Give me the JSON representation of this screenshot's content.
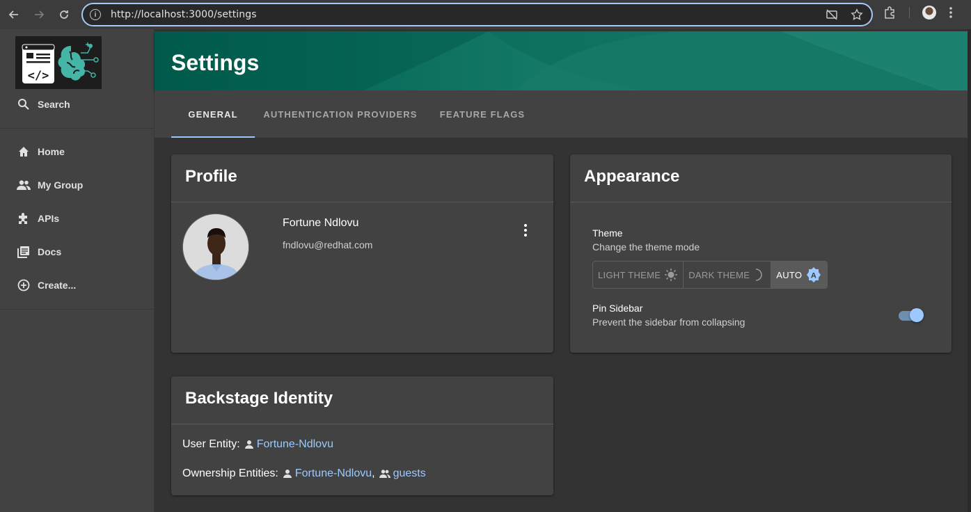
{
  "browser": {
    "url": "http://localhost:3000/settings",
    "back_icon": "arrow-left-icon",
    "forward_icon": "arrow-right-icon",
    "reload_icon": "reload-icon"
  },
  "sidebar": {
    "search_label": "Search",
    "items": [
      {
        "label": "Home",
        "icon": "home-icon"
      },
      {
        "label": "My Group",
        "icon": "group-icon"
      },
      {
        "label": "APIs",
        "icon": "puzzle-icon"
      },
      {
        "label": "Docs",
        "icon": "docs-icon"
      },
      {
        "label": "Create...",
        "icon": "add-circle-icon"
      }
    ]
  },
  "header": {
    "title": "Settings"
  },
  "tabs": [
    {
      "label": "GENERAL",
      "active": true
    },
    {
      "label": "AUTHENTICATION PROVIDERS",
      "active": false
    },
    {
      "label": "FEATURE FLAGS",
      "active": false
    }
  ],
  "profile": {
    "title": "Profile",
    "name": "Fortune Ndlovu",
    "email": "fndlovu@redhat.com"
  },
  "appearance": {
    "title": "Appearance",
    "theme_label": "Theme",
    "theme_desc": "Change the theme mode",
    "theme_options": [
      {
        "label": "LIGHT THEME",
        "icon": "sun-icon"
      },
      {
        "label": "DARK THEME",
        "icon": "moon-icon"
      },
      {
        "label": "AUTO",
        "icon": "auto-theme-icon",
        "selected": true
      }
    ],
    "pin_label": "Pin Sidebar",
    "pin_desc": "Prevent the sidebar from collapsing",
    "pin_enabled": true
  },
  "identity": {
    "title": "Backstage Identity",
    "user_entity_label": "User Entity:",
    "user_entity": "Fortune-Ndlovu",
    "ownership_label": "Ownership Entities:",
    "ownership_user": "Fortune-Ndlovu",
    "ownership_separator": ",",
    "ownership_group": "guests"
  },
  "colors": {
    "accent": "#9cc9ff",
    "header_start": "#005b4b",
    "header_end": "#1a7f6d"
  }
}
